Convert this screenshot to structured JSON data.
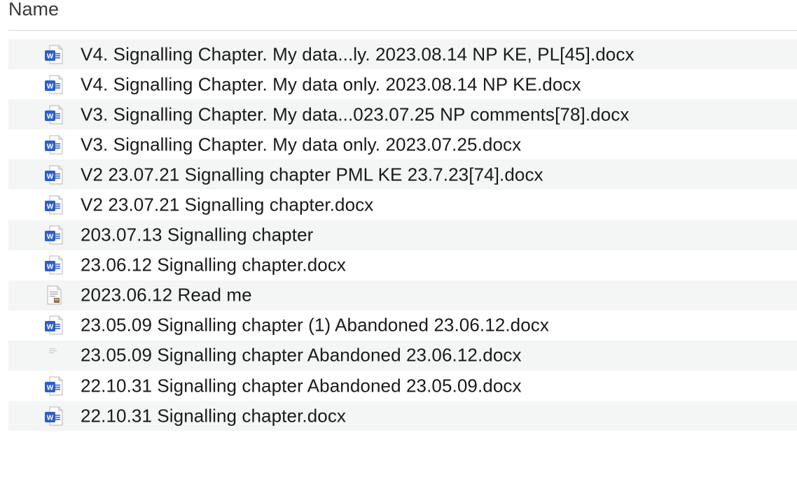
{
  "header": {
    "column_name": "Name"
  },
  "files": [
    {
      "name": "V4. Signalling Chapter. My data...ly. 2023.08.14 NP KE, PL[45].docx",
      "icon": "word-document-icon"
    },
    {
      "name": "V4. Signalling Chapter. My data only. 2023.08.14 NP KE.docx",
      "icon": "word-document-icon"
    },
    {
      "name": "V3. Signalling Chapter. My data...023.07.25 NP comments[78].docx",
      "icon": "word-document-icon"
    },
    {
      "name": "V3. Signalling Chapter. My data only. 2023.07.25.docx",
      "icon": "word-document-icon"
    },
    {
      "name": "V2 23.07.21 Signalling chapter PML KE 23.7.23[74].docx",
      "icon": "word-document-icon"
    },
    {
      "name": "V2 23.07.21 Signalling chapter.docx",
      "icon": "word-document-icon"
    },
    {
      "name": "203.07.13 Signalling chapter",
      "icon": "word-document-icon"
    },
    {
      "name": "23.06.12 Signalling chapter.docx",
      "icon": "word-document-icon"
    },
    {
      "name": "2023.06.12 Read me",
      "icon": "text-document-thumbnail-icon"
    },
    {
      "name": "23.05.09 Signalling chapter (1) Abandoned 23.06.12.docx",
      "icon": "word-document-icon"
    },
    {
      "name": "23.05.09 Signalling chapter Abandoned 23.06.12.docx",
      "icon": "blank-document-icon"
    },
    {
      "name": "22.10.31 Signalling chapter Abandoned 23.05.09.docx",
      "icon": "word-document-icon"
    },
    {
      "name": "22.10.31 Signalling chapter.docx",
      "icon": "word-document-icon"
    }
  ],
  "colors": {
    "word_blue": "#2b5ec9",
    "row_alt": "#f4f5f5",
    "header_border": "#d6d6d6"
  }
}
